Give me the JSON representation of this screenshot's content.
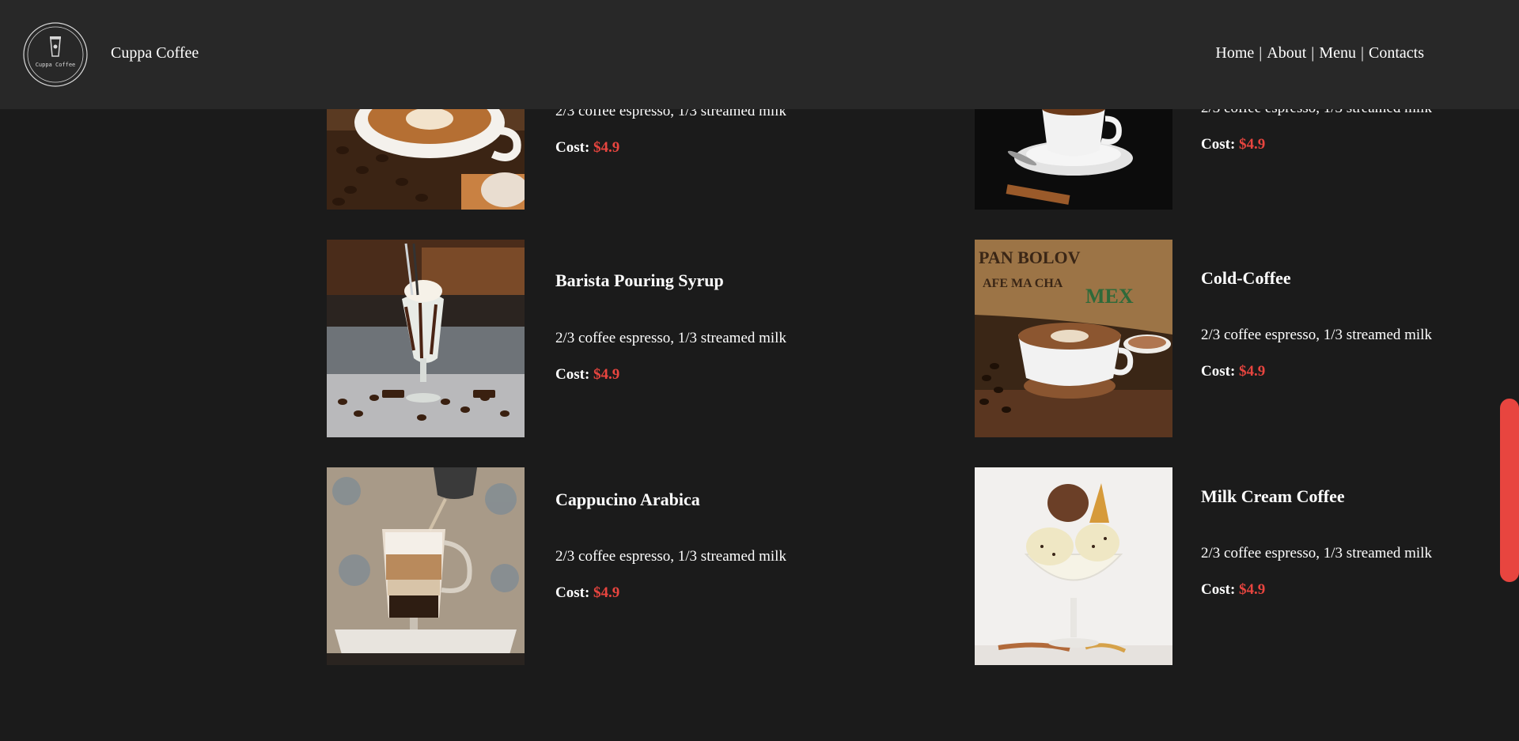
{
  "header": {
    "brand": "Cuppa Coffee",
    "logo_text": "Cuppa Coffee",
    "nav": [
      {
        "label": "Home"
      },
      {
        "label": "About"
      },
      {
        "label": "Menu"
      },
      {
        "label": "Contacts"
      }
    ],
    "nav_separator": "|"
  },
  "menu": {
    "cost_label": "Cost:",
    "items": [
      {
        "name": "",
        "description": "2/3 coffee espresso, 1/3 streamed milk",
        "price": "$4.9",
        "image": "latte-art-cup-with-beans"
      },
      {
        "name": "",
        "description": "2/3 coffee espresso, 1/3 streamed milk",
        "price": "$4.9",
        "image": "espresso-cup-on-saucer"
      },
      {
        "name": "Barista Pouring Syrup",
        "description": "2/3 coffee espresso, 1/3 streamed milk",
        "price": "$4.9",
        "image": "milkshake-glass-with-chocolate"
      },
      {
        "name": "Cold-Coffee",
        "description": "2/3 coffee espresso, 1/3 streamed milk",
        "price": "$4.9",
        "image": "latte-cup-on-burlap"
      },
      {
        "name": "Cappucino Arabica",
        "description": "2/3 coffee espresso, 1/3 streamed milk",
        "price": "$4.9",
        "image": "layered-latte-glass"
      },
      {
        "name": "Milk Cream Coffee",
        "description": "2/3 coffee espresso, 1/3 streamed milk",
        "price": "$4.9",
        "image": "ice-cream-sundae"
      }
    ]
  },
  "colors": {
    "background": "#1b1b1b",
    "header": "#282828",
    "accent": "#e8453f"
  }
}
